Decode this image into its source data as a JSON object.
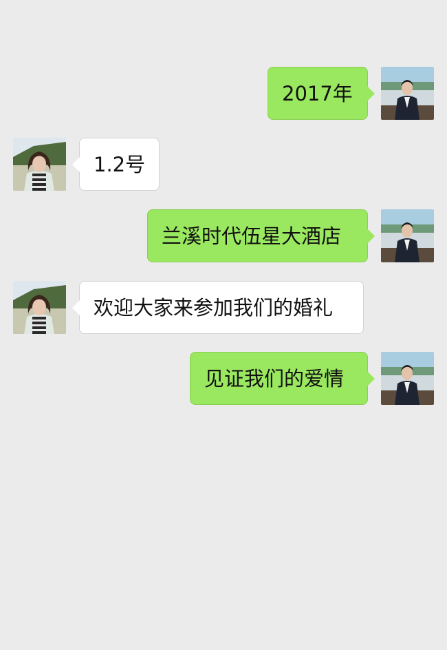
{
  "colors": {
    "background": "#ebebeb",
    "outgoing_bubble": "#9ae85f",
    "incoming_bubble": "#ffffff",
    "text": "#111111"
  },
  "messages": [
    {
      "sender": "me",
      "avatar": "male-avatar",
      "text": "2017年"
    },
    {
      "sender": "other",
      "avatar": "female-avatar",
      "text": "1.2号"
    },
    {
      "sender": "me",
      "avatar": "male-avatar",
      "text": "兰溪时代伍星大酒店"
    },
    {
      "sender": "other",
      "avatar": "female-avatar",
      "text": "欢迎大家来参加我们的婚礼"
    },
    {
      "sender": "me",
      "avatar": "male-avatar",
      "text": "见证我们的爱情"
    }
  ]
}
